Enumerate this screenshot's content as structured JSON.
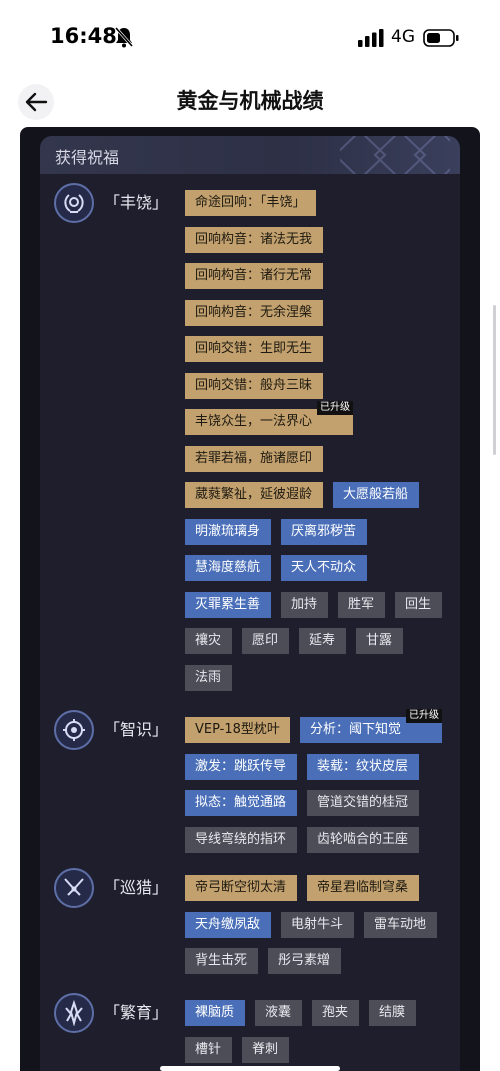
{
  "status_bar": {
    "time": "16:48",
    "network": "4G"
  },
  "nav": {
    "title": "黄金与机械战绩"
  },
  "panel": {
    "title": "获得祝福"
  },
  "upgraded_label": "已升级",
  "groups": [
    {
      "name": "「丰饶」",
      "icon": "abundance-laurel-icon",
      "rows": [
        [
          {
            "text": "命途回响：「丰饶」",
            "color": "gold"
          }
        ],
        [
          {
            "text": "回响构音：诸法无我",
            "color": "gold"
          }
        ],
        [
          {
            "text": "回响构音：诸行无常",
            "color": "gold"
          }
        ],
        [
          {
            "text": "回响构音：无余涅槃",
            "color": "gold"
          }
        ],
        [
          {
            "text": "回响交错：生即无生",
            "color": "gold"
          }
        ],
        [
          {
            "text": "回响交错：般舟三昧",
            "color": "gold"
          }
        ],
        [
          {
            "text": "丰饶众生，一法界心",
            "color": "gold",
            "upgraded": true
          }
        ],
        [
          {
            "text": "若罪若福，施诸愿印",
            "color": "gold"
          }
        ],
        [
          {
            "text": "葳蕤繁祉，延彼遐龄",
            "color": "gold"
          },
          {
            "text": "大愿般若船",
            "color": "blue"
          }
        ],
        [
          {
            "text": "明澈琉璃身",
            "color": "blue"
          },
          {
            "text": "厌离邪秽苦",
            "color": "blue"
          }
        ],
        [
          {
            "text": "慧海度慈航",
            "color": "blue"
          },
          {
            "text": "天人不动众",
            "color": "blue"
          }
        ],
        [
          {
            "text": "灭罪累生善",
            "color": "blue"
          },
          {
            "text": "加持",
            "color": "gray"
          },
          {
            "text": "胜军",
            "color": "gray"
          },
          {
            "text": "回生",
            "color": "gray"
          }
        ],
        [
          {
            "text": "禳灾",
            "color": "gray"
          },
          {
            "text": "愿印",
            "color": "gray"
          },
          {
            "text": "延寿",
            "color": "gray"
          },
          {
            "text": "甘露",
            "color": "gray"
          }
        ],
        [
          {
            "text": "法雨",
            "color": "gray"
          }
        ]
      ]
    },
    {
      "name": "「智识」",
      "icon": "erudition-circuit-icon",
      "rows": [
        [
          {
            "text": "VEP-18型枕叶",
            "color": "gold"
          },
          {
            "text": "分析：阈下知觉",
            "color": "blue",
            "upgraded": true
          }
        ],
        [
          {
            "text": "激发：跳跃传导",
            "color": "blue"
          },
          {
            "text": "装载：纹状皮层",
            "color": "blue"
          }
        ],
        [
          {
            "text": "拟态：触觉通路",
            "color": "blue"
          },
          {
            "text": "管道交错的桂冠",
            "color": "gray"
          }
        ],
        [
          {
            "text": "导线弯绕的指环",
            "color": "gray"
          },
          {
            "text": "齿轮啮合的王座",
            "color": "gray"
          }
        ]
      ]
    },
    {
      "name": "「巡猎」",
      "icon": "hunt-arrow-icon",
      "rows": [
        [
          {
            "text": "帝弓断空彻太清",
            "color": "gold"
          },
          {
            "text": "帝星君临制穹桑",
            "color": "gold"
          }
        ],
        [
          {
            "text": "天舟缴夙敌",
            "color": "blue"
          },
          {
            "text": "电射牛斗",
            "color": "gray"
          },
          {
            "text": "雷车动地",
            "color": "gray"
          }
        ],
        [
          {
            "text": "背生击死",
            "color": "gray"
          },
          {
            "text": "彤弓素矰",
            "color": "gray"
          }
        ]
      ]
    },
    {
      "name": "「繁育」",
      "icon": "propagation-swarm-icon",
      "rows": [
        [
          {
            "text": "裸脑质",
            "color": "blue"
          },
          {
            "text": "液囊",
            "color": "gray"
          },
          {
            "text": "孢夹",
            "color": "gray"
          },
          {
            "text": "结膜",
            "color": "gray"
          }
        ],
        [
          {
            "text": "槽针",
            "color": "gray"
          },
          {
            "text": "脊刺",
            "color": "gray"
          }
        ]
      ]
    }
  ],
  "colors": {
    "gold": "#c2a16f",
    "blue": "#4a6fb8",
    "gray": "#4d4d57",
    "panel_bg": "#1e1e2d",
    "outer_bg": "#13131c"
  }
}
